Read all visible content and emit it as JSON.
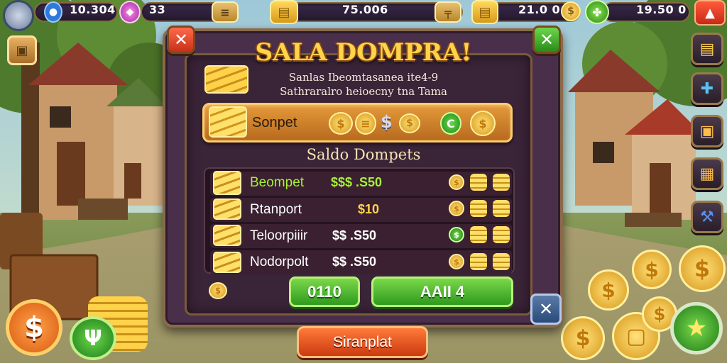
{
  "hud": {
    "player_level": "10.304",
    "gems": "33",
    "gold_center": "75.006",
    "coins_right": "21.0 0",
    "currency_far_right": "19.50 0"
  },
  "dialog": {
    "title": "SALA DOMPRA!",
    "subtitle_line1": "Sanlas Ibeomtasanea ite4-9",
    "subtitle_line2": "Sathraralro heioecny tna Tama",
    "featured": {
      "label": "Sonpet",
      "coin_symbol": "$",
      "badge": "C"
    },
    "section_heading": "Saldo Dompets",
    "rows": [
      {
        "label": "Beompet",
        "price": "$$$ .S50",
        "price_color": "#a6f03a",
        "label_color": "#a6f03a"
      },
      {
        "label": "Rtanport",
        "price": "$10",
        "price_color": "#ffd54a",
        "label_color": "#ffffff"
      },
      {
        "label": "Teloorpiiir",
        "price": "$$ .S50",
        "price_color": "#ffffff",
        "label_color": "#ffffff"
      },
      {
        "label": "Nodorpolt",
        "price": "$$ .S50",
        "price_color": "#ffffff",
        "label_color": "#ffffff"
      }
    ],
    "buy_small_label": "0110",
    "buy_all_label": "AAII 4",
    "close_icon": "x-icon",
    "confirm_icon": "x-icon"
  },
  "bottom_button_label": "Siranplat",
  "colors": {
    "gold": "#ffc83a",
    "green": "#3fae2a",
    "panel": "#4a2f4a",
    "accent_red": "#d83a2a"
  }
}
